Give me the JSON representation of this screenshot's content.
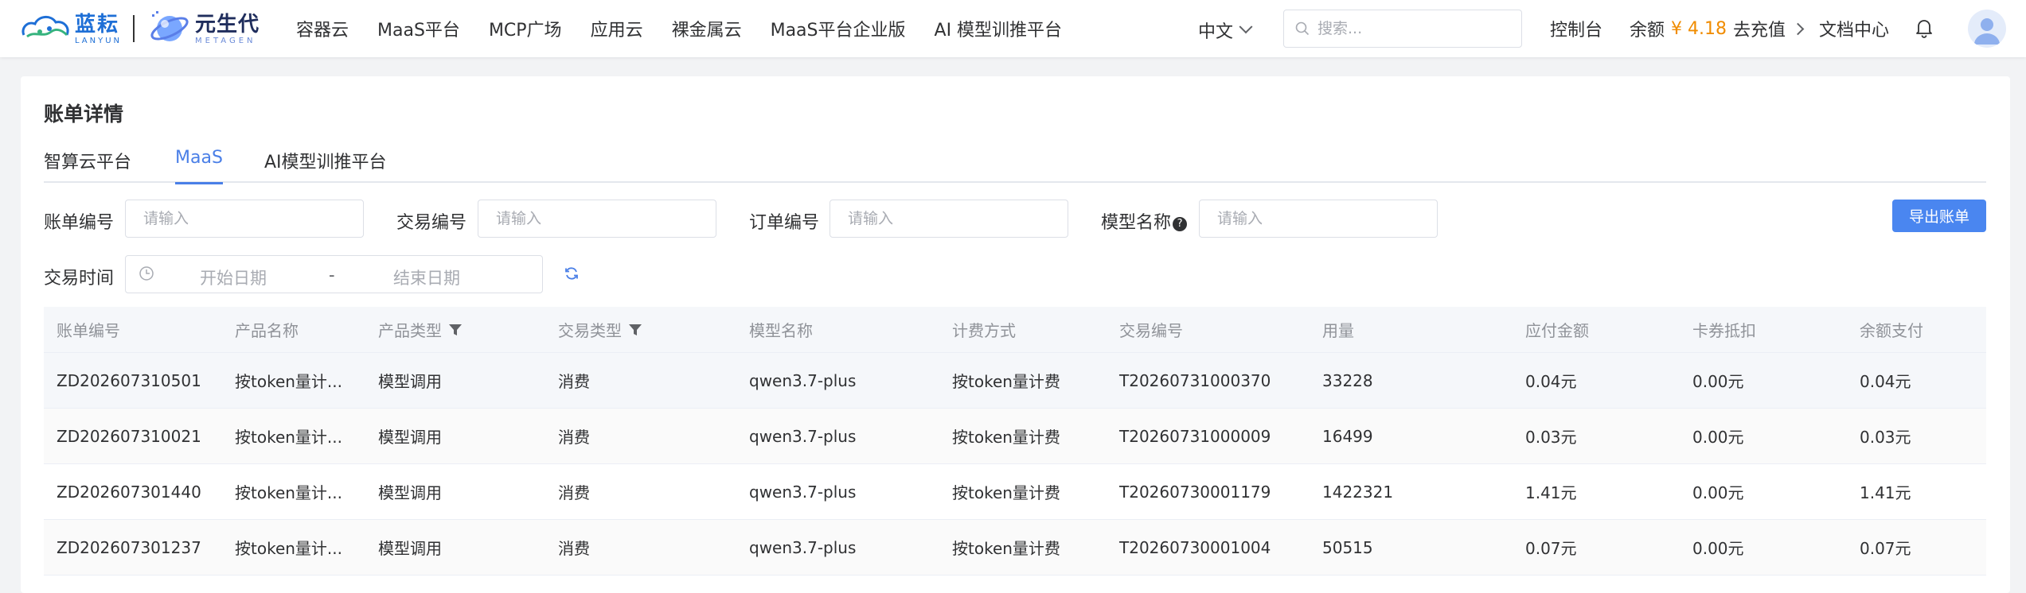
{
  "header": {
    "logo1": {
      "cn": "蓝耘",
      "en": "LANYUN"
    },
    "logo2": {
      "cn": "元生代",
      "en": "METAGEN"
    },
    "nav": [
      "容器云",
      "MaaS平台",
      "MCP广场",
      "应用云",
      "裸金属云",
      "MaaS平台企业版",
      "AI 模型训推平台"
    ],
    "language": "中文",
    "search_placeholder": "搜索...",
    "console": "控制台",
    "balance_label": "余额",
    "balance_amount": "¥ 4.18",
    "recharge": "去充值",
    "docs": "文档中心",
    "icons": {
      "bell": "bell-icon",
      "avatar": "avatar-icon",
      "search": "search-icon"
    }
  },
  "page": {
    "title": "账单详情",
    "tabs": [
      "智算云平台",
      "MaaS",
      "AI模型训推平台"
    ],
    "active_tab": 1
  },
  "filters": {
    "bill_no_label": "账单编号",
    "bill_no_placeholder": "请输入",
    "trade_no_label": "交易编号",
    "trade_no_placeholder": "请输入",
    "order_no_label": "订单编号",
    "order_no_placeholder": "请输入",
    "model_name_label": "模型名称",
    "model_name_placeholder": "请输入",
    "help_mark": "?",
    "trade_time_label": "交易时间",
    "start_date": "开始日期",
    "date_sep": "-",
    "end_date": "结束日期",
    "export": "导出账单"
  },
  "table": {
    "columns": [
      "账单编号",
      "产品名称",
      "产品类型",
      "交易类型",
      "模型名称",
      "计费方式",
      "交易编号",
      "用量",
      "应付金额",
      "卡券抵扣",
      "余额支付"
    ],
    "rows": [
      [
        "ZD202607310501",
        "按token量计...",
        "模型调用",
        "消费",
        "qwen3.7-plus",
        "按token量计费",
        "T20260731000370",
        "33228",
        "0.04元",
        "0.00元",
        "0.04元"
      ],
      [
        "ZD202607310021",
        "按token量计...",
        "模型调用",
        "消费",
        "qwen3.7-plus",
        "按token量计费",
        "T20260731000009",
        "16499",
        "0.03元",
        "0.00元",
        "0.03元"
      ],
      [
        "ZD202607301440",
        "按token量计...",
        "模型调用",
        "消费",
        "qwen3.7-plus",
        "按token量计费",
        "T20260730001179",
        "1422321",
        "1.41元",
        "0.00元",
        "1.41元"
      ],
      [
        "ZD202607301237",
        "按token量计...",
        "模型调用",
        "消费",
        "qwen3.7-plus",
        "按token量计费",
        "T20260730001004",
        "50515",
        "0.07元",
        "0.00元",
        "0.07元"
      ]
    ]
  },
  "colors": {
    "accent": "#4a7fe7",
    "balance": "#f08c00",
    "button": "#4a86f0"
  }
}
